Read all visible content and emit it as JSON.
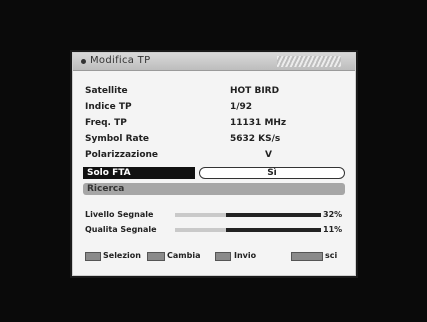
{
  "menu": {
    "title": "Modifica TP"
  },
  "fields": [
    {
      "label": "Satellite",
      "value": "HOT BIRD"
    },
    {
      "label": "Indice TP",
      "value": "1/92"
    },
    {
      "label": "Freq. TP",
      "value": "11131 MHz"
    },
    {
      "label": "Symbol Rate",
      "value": "5632 KS/s"
    },
    {
      "label": "Polarizzazione",
      "value": "V"
    }
  ],
  "fta_option": {
    "label": "Solo FTA",
    "value": "Sì"
  },
  "search_label": "Ricerca",
  "signal": {
    "level": {
      "label": "Livello Segnale",
      "value": "32%",
      "fraction": 0.32
    },
    "quality": {
      "label": "Qualita Segnale",
      "value": "11%",
      "fraction": 0.11
    }
  },
  "footer": {
    "select_label": "Selezion",
    "change_label": "Cambia",
    "send_label": "Invio",
    "exit_label": "sci"
  }
}
